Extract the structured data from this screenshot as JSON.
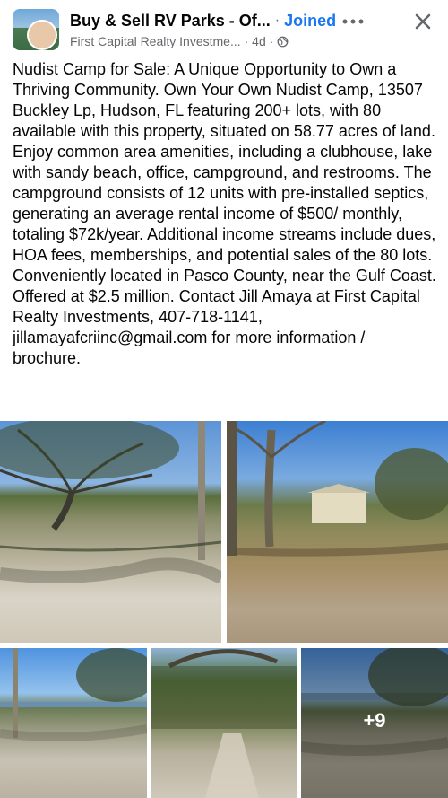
{
  "header": {
    "group_name": "Buy & Sell RV Parks - Of...",
    "dot": "·",
    "membership": "Joined",
    "author": "First Capital Realty Investme...",
    "time": "· 4d ·",
    "privacy_icon": "globe-icon",
    "more_icon": "more-icon",
    "close_icon": "close-icon"
  },
  "post": {
    "text": "Nudist Camp for Sale: A Unique Opportunity to Own a Thriving Community. Own Your Own Nudist Camp, 13507 Buckley Lp, Hudson, FL featuring 200+ lots, with 80 available with this property, situated on 58.77 acres of land. Enjoy common area amenities, including a clubhouse, lake with sandy beach, office, campground, and restrooms. The campground consists of 12 units with pre-installed septics, generating an average rental income of $500/ monthly, totaling $72k/year. Additional income streams include dues, HOA fees, memberships, and potential sales of the 80 lots. Conveniently located in Pasco County, near the Gulf Coast. Offered at $2.5 million. Contact Jill Amaya at First Capital Realty Investments, 407-718-1141, jillamayafcriinc@gmail.com for more information / brochure."
  },
  "photos": {
    "more_count": "+9"
  },
  "colors": {
    "accent": "#1877f2",
    "secondary_text": "#65676b"
  }
}
